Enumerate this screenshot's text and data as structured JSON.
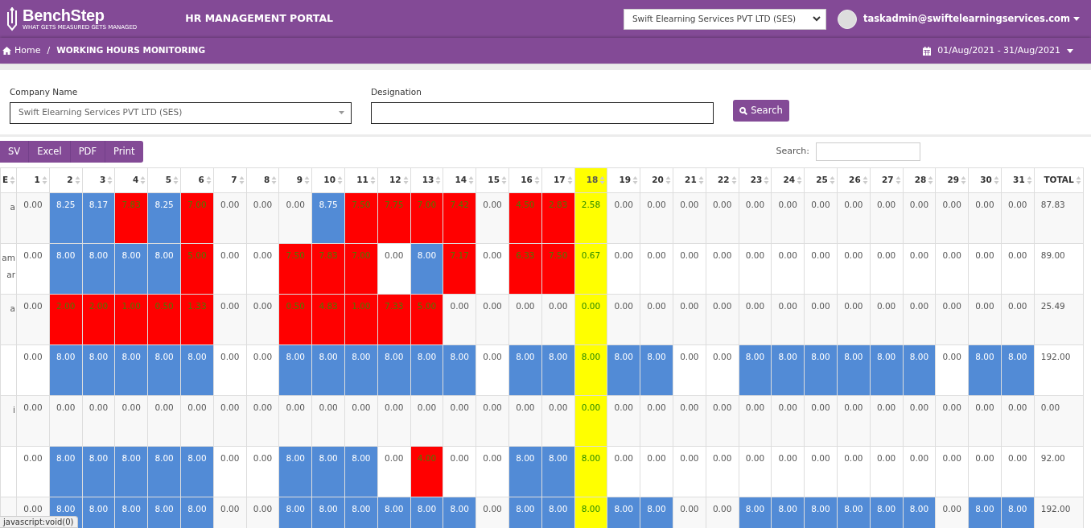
{
  "header": {
    "logo_name": "BenchStep",
    "logo_tagline": "WHAT GETS MEASURED GETS MANAGED",
    "portal_title": "HR MANAGEMENT PORTAL",
    "company_select": "Swift Elearning Services PVT LTD (SES)",
    "user": "taskadmin@swiftelearningservices.com"
  },
  "breadcrumb": [
    {
      "label": "Home",
      "kind": "home"
    },
    {
      "label": "WORKING HOURS MONITORING",
      "kind": "current"
    }
  ],
  "breadcrumb_separator": "/",
  "date_range": "01/Aug/2021 - 31/Aug/2021",
  "filters": {
    "company": {
      "label": "Company Name",
      "value": "Swift Elearning Services PVT LTD (SES)"
    },
    "designation": {
      "label": "Designation"
    },
    "search_button": "Search"
  },
  "export_buttons": [
    "SV",
    "Excel",
    "PDF",
    "Print"
  ],
  "table_search": {
    "label": "Search:"
  },
  "table": {
    "columns": [
      {
        "label": "E",
        "today": false
      },
      {
        "label": "1",
        "today": false
      },
      {
        "label": "2",
        "today": false
      },
      {
        "label": "3",
        "today": false
      },
      {
        "label": "4",
        "today": false
      },
      {
        "label": "5",
        "today": false
      },
      {
        "label": "6",
        "today": false
      },
      {
        "label": "7",
        "today": false
      },
      {
        "label": "8",
        "today": false
      },
      {
        "label": "9",
        "today": false
      },
      {
        "label": "10",
        "today": false
      },
      {
        "label": "11",
        "today": false
      },
      {
        "label": "12",
        "today": false
      },
      {
        "label": "13",
        "today": false
      },
      {
        "label": "14",
        "today": false
      },
      {
        "label": "15",
        "today": false
      },
      {
        "label": "16",
        "today": false
      },
      {
        "label": "17",
        "today": false
      },
      {
        "label": "18",
        "today": true
      },
      {
        "label": "19",
        "today": false
      },
      {
        "label": "20",
        "today": false
      },
      {
        "label": "21",
        "today": false
      },
      {
        "label": "22",
        "today": false
      },
      {
        "label": "23",
        "today": false
      },
      {
        "label": "24",
        "today": false
      },
      {
        "label": "25",
        "today": false
      },
      {
        "label": "26",
        "today": false
      },
      {
        "label": "27",
        "today": false
      },
      {
        "label": "28",
        "today": false
      },
      {
        "label": "29",
        "today": false
      },
      {
        "label": "30",
        "today": false
      },
      {
        "label": "31",
        "today": false
      },
      {
        "label": "TOTAL",
        "today": false
      }
    ],
    "rows": [
      {
        "cells": [
          {
            "value": "a"
          },
          {
            "value": "0.00"
          },
          {
            "value": "8.25",
            "color": "#528bd6"
          },
          {
            "value": "8.17",
            "color": "#528bd6"
          },
          {
            "value": "7.83",
            "color": "#ff0000"
          },
          {
            "value": "8.25",
            "color": "#528bd6"
          },
          {
            "value": "7.00",
            "color": "#ff0000"
          },
          {
            "value": "0.00"
          },
          {
            "value": "0.00"
          },
          {
            "value": "0.00"
          },
          {
            "value": "8.75",
            "color": "#528bd6"
          },
          {
            "value": "7.50",
            "color": "#ff0000"
          },
          {
            "value": "7.75",
            "color": "#ff0000"
          },
          {
            "value": "7.00",
            "color": "#ff0000"
          },
          {
            "value": "7.42",
            "color": "#ff0000"
          },
          {
            "value": "0.00"
          },
          {
            "value": "4.50",
            "color": "#ff0000"
          },
          {
            "value": "2.83",
            "color": "#ff0000"
          },
          {
            "value": "2.58"
          },
          {
            "value": "0.00"
          },
          {
            "value": "0.00"
          },
          {
            "value": "0.00"
          },
          {
            "value": "0.00"
          },
          {
            "value": "0.00"
          },
          {
            "value": "0.00"
          },
          {
            "value": "0.00"
          },
          {
            "value": "0.00"
          },
          {
            "value": "0.00"
          },
          {
            "value": "0.00"
          },
          {
            "value": "0.00"
          },
          {
            "value": "0.00"
          },
          {
            "value": "0.00"
          },
          {
            "value": "87.83"
          }
        ]
      },
      {
        "cells": [
          {
            "value": "am ar"
          },
          {
            "value": "0.00"
          },
          {
            "value": "8.00",
            "color": "#528bd6"
          },
          {
            "value": "8.00",
            "color": "#528bd6"
          },
          {
            "value": "8.00",
            "color": "#528bd6"
          },
          {
            "value": "8.00",
            "color": "#528bd6"
          },
          {
            "value": "5.00",
            "color": "#ff0000"
          },
          {
            "value": "0.00"
          },
          {
            "value": "0.00"
          },
          {
            "value": "7.50",
            "color": "#ff0000"
          },
          {
            "value": "7.83",
            "color": "#ff0000"
          },
          {
            "value": "7.00",
            "color": "#ff0000"
          },
          {
            "value": "0.00"
          },
          {
            "value": "8.00",
            "color": "#528bd6"
          },
          {
            "value": "7.17",
            "color": "#ff0000"
          },
          {
            "value": "0.00"
          },
          {
            "value": "6.33",
            "color": "#ff0000"
          },
          {
            "value": "7.50",
            "color": "#ff0000"
          },
          {
            "value": "0.67"
          },
          {
            "value": "0.00"
          },
          {
            "value": "0.00"
          },
          {
            "value": "0.00"
          },
          {
            "value": "0.00"
          },
          {
            "value": "0.00"
          },
          {
            "value": "0.00"
          },
          {
            "value": "0.00"
          },
          {
            "value": "0.00"
          },
          {
            "value": "0.00"
          },
          {
            "value": "0.00"
          },
          {
            "value": "0.00"
          },
          {
            "value": "0.00"
          },
          {
            "value": "0.00"
          },
          {
            "value": "89.00"
          }
        ]
      },
      {
        "cells": [
          {
            "value": "a"
          },
          {
            "value": "0.00"
          },
          {
            "value": "2.00",
            "color": "#ff0000"
          },
          {
            "value": "2.00",
            "color": "#ff0000"
          },
          {
            "value": "1.00",
            "color": "#ff0000"
          },
          {
            "value": "0.50",
            "color": "#ff0000"
          },
          {
            "value": "1.33",
            "color": "#ff0000"
          },
          {
            "value": "0.00"
          },
          {
            "value": "0.00"
          },
          {
            "value": "0.50",
            "color": "#ff0000"
          },
          {
            "value": "4.83",
            "color": "#ff0000"
          },
          {
            "value": "1.00",
            "color": "#ff0000"
          },
          {
            "value": "7.33",
            "color": "#ff0000"
          },
          {
            "value": "5.00",
            "color": "#ff0000"
          },
          {
            "value": "0.00"
          },
          {
            "value": "0.00"
          },
          {
            "value": "0.00"
          },
          {
            "value": "0.00"
          },
          {
            "value": "0.00"
          },
          {
            "value": "0.00"
          },
          {
            "value": "0.00"
          },
          {
            "value": "0.00"
          },
          {
            "value": "0.00"
          },
          {
            "value": "0.00"
          },
          {
            "value": "0.00"
          },
          {
            "value": "0.00"
          },
          {
            "value": "0.00"
          },
          {
            "value": "0.00"
          },
          {
            "value": "0.00"
          },
          {
            "value": "0.00"
          },
          {
            "value": "0.00"
          },
          {
            "value": "0.00"
          },
          {
            "value": "25.49"
          }
        ]
      },
      {
        "cells": [
          {},
          {
            "value": "0.00"
          },
          {
            "value": "8.00",
            "color": "#528bd6"
          },
          {
            "value": "8.00",
            "color": "#528bd6"
          },
          {
            "value": "8.00",
            "color": "#528bd6"
          },
          {
            "value": "8.00",
            "color": "#528bd6"
          },
          {
            "value": "8.00",
            "color": "#528bd6"
          },
          {
            "value": "0.00"
          },
          {
            "value": "0.00"
          },
          {
            "value": "8.00",
            "color": "#528bd6"
          },
          {
            "value": "8.00",
            "color": "#528bd6"
          },
          {
            "value": "8.00",
            "color": "#528bd6"
          },
          {
            "value": "8.00",
            "color": "#528bd6"
          },
          {
            "value": "8.00",
            "color": "#528bd6"
          },
          {
            "value": "8.00",
            "color": "#528bd6"
          },
          {
            "value": "0.00"
          },
          {
            "value": "8.00",
            "color": "#528bd6"
          },
          {
            "value": "8.00",
            "color": "#528bd6"
          },
          {
            "value": "8.00"
          },
          {
            "value": "8.00",
            "color": "#528bd6"
          },
          {
            "value": "8.00",
            "color": "#528bd6"
          },
          {
            "value": "0.00"
          },
          {
            "value": "0.00"
          },
          {
            "value": "8.00",
            "color": "#528bd6"
          },
          {
            "value": "8.00",
            "color": "#528bd6"
          },
          {
            "value": "8.00",
            "color": "#528bd6"
          },
          {
            "value": "8.00",
            "color": "#528bd6"
          },
          {
            "value": "8.00",
            "color": "#528bd6"
          },
          {
            "value": "8.00",
            "color": "#528bd6"
          },
          {
            "value": "0.00"
          },
          {
            "value": "8.00",
            "color": "#528bd6"
          },
          {
            "value": "8.00",
            "color": "#528bd6"
          },
          {
            "value": "192.00"
          }
        ]
      },
      {
        "cells": [
          {
            "value": "i"
          },
          {
            "value": "0.00"
          },
          {
            "value": "0.00"
          },
          {
            "value": "0.00"
          },
          {
            "value": "0.00"
          },
          {
            "value": "0.00"
          },
          {
            "value": "0.00"
          },
          {
            "value": "0.00"
          },
          {
            "value": "0.00"
          },
          {
            "value": "0.00"
          },
          {
            "value": "0.00"
          },
          {
            "value": "0.00"
          },
          {
            "value": "0.00"
          },
          {
            "value": "0.00"
          },
          {
            "value": "0.00"
          },
          {
            "value": "0.00"
          },
          {
            "value": "0.00"
          },
          {
            "value": "0.00"
          },
          {
            "value": "0.00"
          },
          {
            "value": "0.00"
          },
          {
            "value": "0.00"
          },
          {
            "value": "0.00"
          },
          {
            "value": "0.00"
          },
          {
            "value": "0.00"
          },
          {
            "value": "0.00"
          },
          {
            "value": "0.00"
          },
          {
            "value": "0.00"
          },
          {
            "value": "0.00"
          },
          {
            "value": "0.00"
          },
          {
            "value": "0.00"
          },
          {
            "value": "0.00"
          },
          {
            "value": "0.00"
          },
          {
            "value": "0.00"
          }
        ]
      },
      {
        "cells": [
          {},
          {
            "value": "0.00"
          },
          {
            "value": "8.00",
            "color": "#528bd6"
          },
          {
            "value": "8.00",
            "color": "#528bd6"
          },
          {
            "value": "8.00",
            "color": "#528bd6"
          },
          {
            "value": "8.00",
            "color": "#528bd6"
          },
          {
            "value": "8.00",
            "color": "#528bd6"
          },
          {
            "value": "0.00"
          },
          {
            "value": "0.00"
          },
          {
            "value": "8.00",
            "color": "#528bd6"
          },
          {
            "value": "8.00",
            "color": "#528bd6"
          },
          {
            "value": "8.00",
            "color": "#528bd6"
          },
          {
            "value": "0.00"
          },
          {
            "value": "4.00",
            "color": "#ff0000"
          },
          {
            "value": "0.00"
          },
          {
            "value": "0.00"
          },
          {
            "value": "8.00",
            "color": "#528bd6"
          },
          {
            "value": "8.00",
            "color": "#528bd6"
          },
          {
            "value": "8.00"
          },
          {
            "value": "0.00"
          },
          {
            "value": "0.00"
          },
          {
            "value": "0.00"
          },
          {
            "value": "0.00"
          },
          {
            "value": "0.00"
          },
          {
            "value": "0.00"
          },
          {
            "value": "0.00"
          },
          {
            "value": "0.00"
          },
          {
            "value": "0.00"
          },
          {
            "value": "0.00"
          },
          {
            "value": "0.00"
          },
          {
            "value": "0.00"
          },
          {
            "value": "0.00"
          },
          {
            "value": "92.00"
          }
        ]
      },
      {
        "cells": [
          {},
          {
            "value": "0.00"
          },
          {
            "value": "8.00",
            "color": "#528bd6"
          },
          {
            "value": "8.00",
            "color": "#528bd6"
          },
          {
            "value": "8.00",
            "color": "#528bd6"
          },
          {
            "value": "8.00",
            "color": "#528bd6"
          },
          {
            "value": "8.00",
            "color": "#528bd6"
          },
          {
            "value": "0.00"
          },
          {
            "value": "0.00"
          },
          {
            "value": "8.00",
            "color": "#528bd6"
          },
          {
            "value": "8.00",
            "color": "#528bd6"
          },
          {
            "value": "8.00",
            "color": "#528bd6"
          },
          {
            "value": "8.00",
            "color": "#528bd6"
          },
          {
            "value": "8.00",
            "color": "#528bd6"
          },
          {
            "value": "8.00",
            "color": "#528bd6"
          },
          {
            "value": "0.00"
          },
          {
            "value": "8.00",
            "color": "#528bd6"
          },
          {
            "value": "8.00",
            "color": "#528bd6"
          },
          {
            "value": "8.00"
          },
          {
            "value": "8.00",
            "color": "#528bd6"
          },
          {
            "value": "8.00",
            "color": "#528bd6"
          },
          {
            "value": "0.00"
          },
          {
            "value": "0.00"
          },
          {
            "value": "8.00",
            "color": "#528bd6"
          },
          {
            "value": "8.00",
            "color": "#528bd6"
          },
          {
            "value": "8.00",
            "color": "#528bd6"
          },
          {
            "value": "8.00",
            "color": "#528bd6"
          },
          {
            "value": "8.00",
            "color": "#528bd6"
          },
          {
            "value": "8.00",
            "color": "#528bd6"
          },
          {
            "value": "0.00"
          },
          {
            "value": "8.00",
            "color": "#528bd6"
          },
          {
            "value": "8.00",
            "color": "#528bd6"
          },
          {
            "value": "192.00"
          }
        ]
      }
    ]
  },
  "status_tooltip": "javascript:void(0)"
}
